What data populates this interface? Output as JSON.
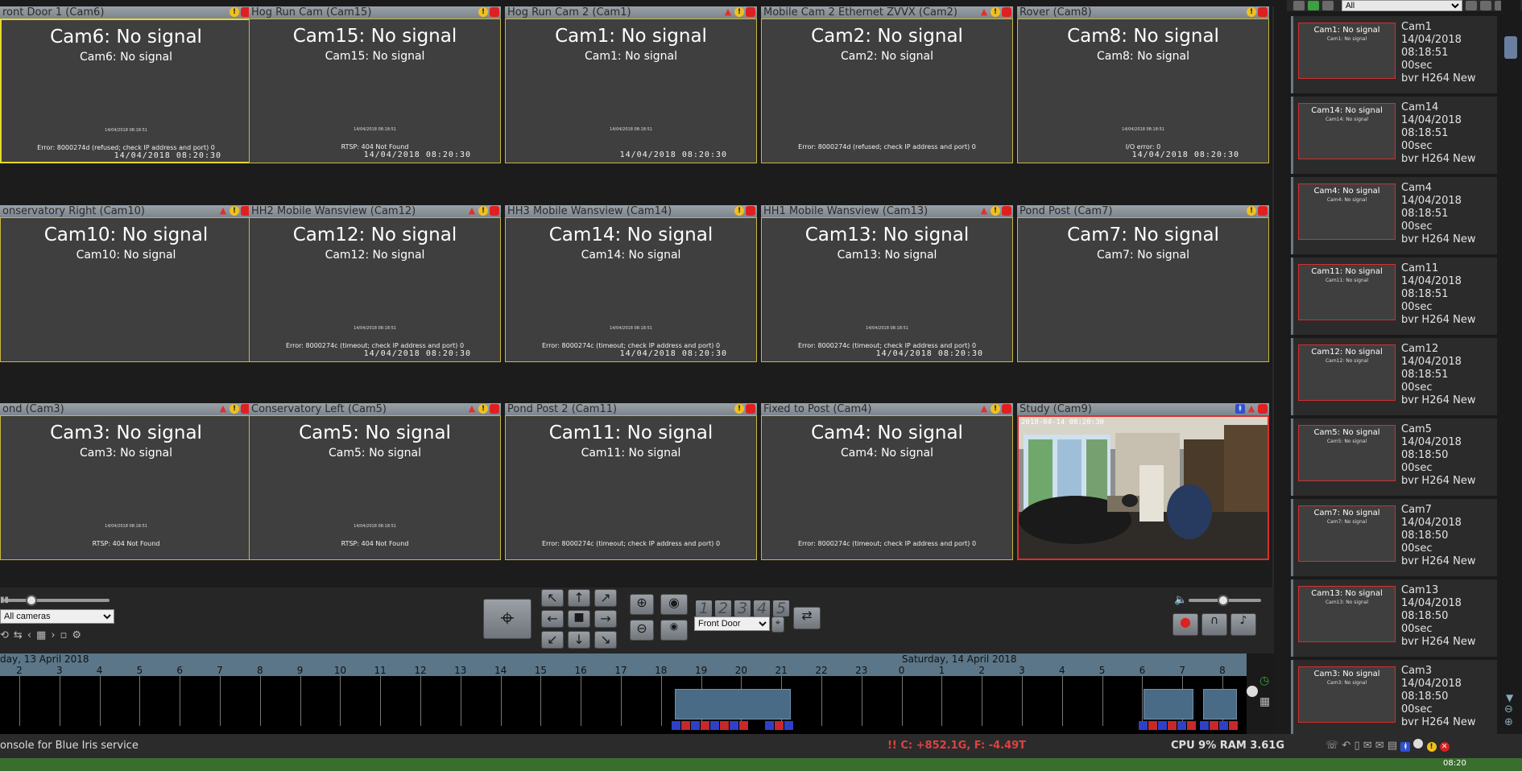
{
  "cameras": [
    {
      "title": "ront Door 1 (Cam6)",
      "big": "Cam6: No signal",
      "small": "Cam6: No signal",
      "micro": "14/04/2018 08:18:51",
      "err": "Error: 8000274d (refused; check IP address and port) 0",
      "ts": "14/04/2018 08:20:30",
      "icons": [
        "warn",
        "rec"
      ],
      "selected": true
    },
    {
      "title": "Hog Run Cam (Cam15)",
      "big": "Cam15: No signal",
      "small": "Cam15: No signal",
      "micro": "14/04/2018 08:18:51",
      "err": "RTSP: 404 Not Found",
      "ts": "14/04/2018 08:20:30",
      "icons": [
        "warn",
        "rec"
      ]
    },
    {
      "title": "Hog Run Cam 2 (Cam1)",
      "big": "Cam1: No signal",
      "small": "Cam1: No signal",
      "micro": "14/04/2018 08:18:51",
      "err": "",
      "ts": "14/04/2018 08:20:30",
      "icons": [
        "tri",
        "warn",
        "rec"
      ]
    },
    {
      "title": "Mobile Cam 2 Ethernet ZVVX (Cam2)",
      "big": "Cam2: No signal",
      "small": "Cam2: No signal",
      "micro": "",
      "err": "Error: 8000274d (refused; check IP address and port) 0",
      "ts": "",
      "icons": [
        "tri",
        "warn",
        "rec"
      ]
    },
    {
      "title": "Rover (Cam8)",
      "big": "Cam8: No signal",
      "small": "Cam8: No signal",
      "micro": "14/04/2018 08:18:51",
      "err": "I/O error: 0",
      "ts": "14/04/2018 08:20:30",
      "icons": [
        "warn",
        "rec"
      ]
    },
    {
      "title": "onservatory Right (Cam10)",
      "big": "Cam10: No signal",
      "small": "Cam10: No signal",
      "micro": "",
      "err": "",
      "ts": "",
      "icons": [
        "tri",
        "warn",
        "rec"
      ]
    },
    {
      "title": "HH2 Mobile Wansview (Cam12)",
      "big": "Cam12: No signal",
      "small": "Cam12: No signal",
      "micro": "14/04/2018 08:18:51",
      "err": "Error: 8000274c (timeout; check IP address and port) 0",
      "ts": "14/04/2018 08:20:30",
      "icons": [
        "tri",
        "warn",
        "rec"
      ]
    },
    {
      "title": "HH3 Mobile Wansview (Cam14)",
      "big": "Cam14: No signal",
      "small": "Cam14: No signal",
      "micro": "14/04/2018 08:18:51",
      "err": "Error: 8000274c (timeout; check IP address and port) 0",
      "ts": "14/04/2018 08:20:30",
      "icons": [
        "warn",
        "rec"
      ]
    },
    {
      "title": "HH1 Mobile Wansview (Cam13)",
      "big": "Cam13: No signal",
      "small": "Cam13: No signal",
      "micro": "14/04/2018 08:18:51",
      "err": "Error: 8000274c (timeout; check IP address and port) 0",
      "ts": "14/04/2018 08:20:30",
      "icons": [
        "tri",
        "warn",
        "rec"
      ]
    },
    {
      "title": "Pond Post (Cam7)",
      "big": "Cam7: No signal",
      "small": "Cam7: No signal",
      "micro": "",
      "err": "",
      "ts": "",
      "icons": [
        "warn",
        "rec"
      ]
    },
    {
      "title": "ond (Cam3)",
      "big": "Cam3: No signal",
      "small": "Cam3: No signal",
      "micro": "14/04/2018 08:18:51",
      "err": "RTSP: 404 Not Found",
      "ts": "",
      "icons": [
        "tri",
        "warn",
        "rec"
      ]
    },
    {
      "title": "Conservatory Left (Cam5)",
      "big": "Cam5: No signal",
      "small": "Cam5: No signal",
      "micro": "14/04/2018 08:18:51",
      "err": "RTSP: 404 Not Found",
      "ts": "",
      "icons": [
        "tri",
        "warn",
        "rec"
      ]
    },
    {
      "title": "Pond Post 2 (Cam11)",
      "big": "Cam11: No signal",
      "small": "Cam11: No signal",
      "micro": "",
      "err": "Error: 8000274c (timeout; check IP address and port) 0",
      "ts": "",
      "icons": [
        "warn",
        "rec"
      ]
    },
    {
      "title": "Fixed to Post (Cam4)",
      "big": "Cam4: No signal",
      "small": "Cam4: No signal",
      "micro": "",
      "err": "Error: 8000274c (timeout; check IP address and port) 0",
      "ts": "",
      "icons": [
        "tri",
        "warn",
        "rec"
      ]
    },
    {
      "title": "Study (Cam9)",
      "big": "",
      "small": "",
      "micro": "",
      "err": "",
      "ts": "2018-04-14 08:20:30",
      "icons": [
        "walk",
        "tri",
        "rec"
      ],
      "live": true
    }
  ],
  "clips": [
    {
      "thumb": "Cam1: No signal",
      "name": "Cam1",
      "date": "14/04/2018",
      "time": "08:18:51",
      "dur": "00sec",
      "codec": "bvr H264 New"
    },
    {
      "thumb": "Cam14: No signal",
      "name": "Cam14",
      "date": "14/04/2018",
      "time": "08:18:51",
      "dur": "00sec",
      "codec": "bvr H264 New"
    },
    {
      "thumb": "Cam4: No signal",
      "name": "Cam4",
      "date": "14/04/2018",
      "time": "08:18:51",
      "dur": "00sec",
      "codec": "bvr H264 New"
    },
    {
      "thumb": "Cam11: No signal",
      "name": "Cam11",
      "date": "14/04/2018",
      "time": "08:18:51",
      "dur": "00sec",
      "codec": "bvr H264 New"
    },
    {
      "thumb": "Cam12: No signal",
      "name": "Cam12",
      "date": "14/04/2018",
      "time": "08:18:51",
      "dur": "00sec",
      "codec": "bvr H264 New"
    },
    {
      "thumb": "Cam5: No signal",
      "name": "Cam5",
      "date": "14/04/2018",
      "time": "08:18:50",
      "dur": "00sec",
      "codec": "bvr H264 New"
    },
    {
      "thumb": "Cam7: No signal",
      "name": "Cam7",
      "date": "14/04/2018",
      "time": "08:18:50",
      "dur": "00sec",
      "codec": "bvr H264 New"
    },
    {
      "thumb": "Cam13: No signal",
      "name": "Cam13",
      "date": "14/04/2018",
      "time": "08:18:50",
      "dur": "00sec",
      "codec": "bvr H264 New"
    },
    {
      "thumb": "Cam3: No signal",
      "name": "Cam3",
      "date": "14/04/2018",
      "time": "08:18:50",
      "dur": "00sec",
      "codec": "bvr H264 New"
    }
  ],
  "cliplist": {
    "filter": "All"
  },
  "controls": {
    "camera_group": "All cameras",
    "profile": "Front Door",
    "profile_numbers": [
      "1",
      "2",
      "3",
      "4",
      "5"
    ]
  },
  "timeline": {
    "date_left": "day, 13 April 2018",
    "date_right": "Saturday, 14 April 2018",
    "hours": [
      "2",
      "3",
      "4",
      "5",
      "6",
      "7",
      "8",
      "9",
      "10",
      "11",
      "12",
      "13",
      "14",
      "15",
      "16",
      "17",
      "18",
      "19",
      "20",
      "21",
      "22",
      "23",
      "0",
      "1",
      "2",
      "3",
      "4",
      "5",
      "6",
      "7",
      "8"
    ]
  },
  "status": {
    "left": "onsole for Blue Iris service",
    "disk": "!! C: +852.1G, F: -4.49T",
    "cpu": "CPU 9% RAM 3.61G"
  },
  "taskbar": {
    "clock": "08:20"
  },
  "colors": {
    "accent": "#e6d82a",
    "warn": "#f0c020",
    "rec": "#e02020",
    "disk_alert": "#e04040"
  }
}
